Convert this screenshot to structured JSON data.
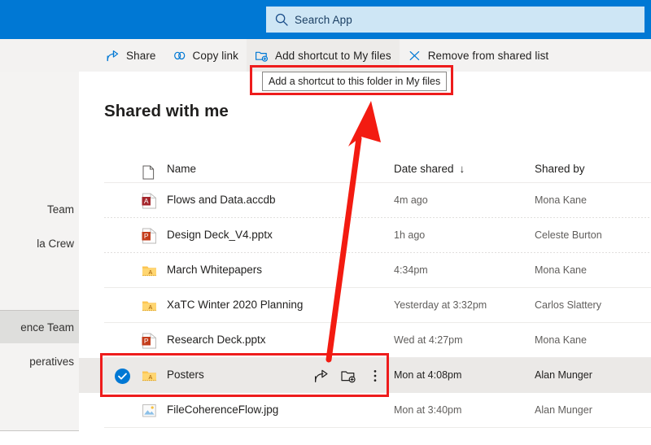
{
  "suite": {
    "search": {
      "placeholder": "Search App",
      "icon": "search-icon"
    },
    "bar_color": "#0078d4",
    "search_bg": "#cee6f5"
  },
  "commandbar": {
    "items": [
      {
        "label": "Share",
        "icon": "share-icon",
        "hovered": false
      },
      {
        "label": "Copy link",
        "icon": "link-icon",
        "hovered": false
      },
      {
        "label": "Add shortcut to My files",
        "icon": "add-shortcut-folder-icon",
        "hovered": true
      },
      {
        "label": "Remove from shared list",
        "icon": "close-x-icon",
        "hovered": false
      }
    ]
  },
  "tooltip": {
    "text": "Add a shortcut to this folder in My files"
  },
  "sidebar": {
    "items": [
      {
        "label": "Team",
        "selected": false
      },
      {
        "label": "la Crew",
        "selected": false
      },
      {
        "label": "ence Team",
        "selected": false
      },
      {
        "label": "peratives",
        "selected": false
      }
    ]
  },
  "main": {
    "title": "Shared with me",
    "columns": [
      {
        "label": "Name",
        "icon": "file-icon",
        "sorted": false
      },
      {
        "label": "Date shared",
        "sorted": true,
        "sort_glyph": "↓"
      },
      {
        "label": "Shared by",
        "sorted": false
      }
    ],
    "rows": [
      {
        "name": "Flows and Data.accdb",
        "date": "4m ago",
        "owner": "Mona Kane",
        "icon": "access-file-icon",
        "selected": false
      },
      {
        "name": "Design Deck_V4.pptx",
        "date": "1h ago",
        "owner": "Celeste Burton",
        "icon": "powerpoint-file-icon",
        "selected": false
      },
      {
        "name": "March Whitepapers",
        "date": "4:34pm",
        "owner": "Mona Kane",
        "icon": "shared-folder-icon",
        "selected": false
      },
      {
        "name": "XaTC Winter 2020 Planning",
        "date": "Yesterday at 3:32pm",
        "owner": "Carlos Slattery",
        "icon": "shared-folder-icon",
        "selected": false
      },
      {
        "name": "Research Deck.pptx",
        "date": "Wed at 4:27pm",
        "owner": "Mona Kane",
        "icon": "powerpoint-file-icon",
        "selected": false
      },
      {
        "name": "Posters",
        "date": "Mon at 4:08pm",
        "owner": "Alan Munger",
        "icon": "shared-folder-icon",
        "selected": true,
        "actions": [
          {
            "name": "share-row-icon",
            "label": "Share"
          },
          {
            "name": "add-shortcut-row-icon",
            "label": "Add shortcut to My files"
          },
          {
            "name": "more-options-icon",
            "label": "Show actions"
          }
        ]
      },
      {
        "name": "FileCoherenceFlow.jpg",
        "date": "Mon at 3:40pm",
        "owner": "Alan Munger",
        "icon": "image-file-icon",
        "selected": false
      }
    ]
  },
  "annotations": {
    "highlight_color": "#ee1c1c",
    "boxes": [
      {
        "name": "tooltip-highlight"
      },
      {
        "name": "selected-row-highlight"
      }
    ],
    "arrow": {
      "name": "pointer-arrow",
      "from_row": "Posters",
      "to": "tooltip"
    }
  }
}
